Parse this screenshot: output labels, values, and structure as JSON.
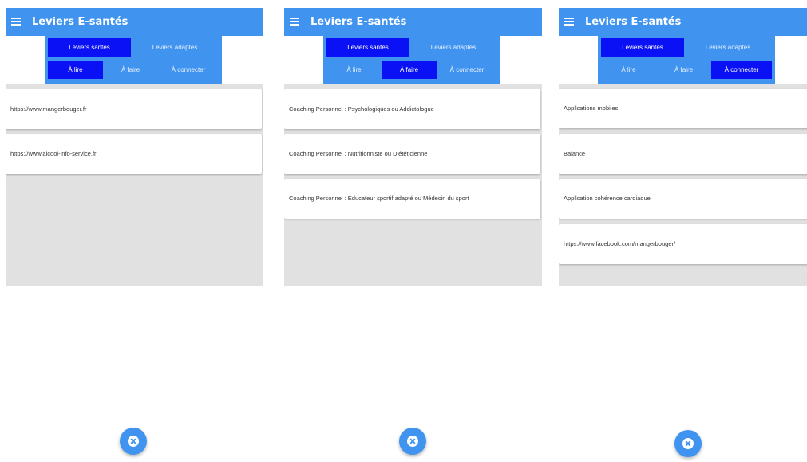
{
  "colors": {
    "primary": "#4094f0",
    "active_tab": "#0a12f5",
    "content_bg": "#e1e1e1"
  },
  "icons": {
    "menu": "hamburger-menu-icon",
    "fab": "close-circle-icon"
  },
  "panels": [
    {
      "app_title": "Leviers E-santés",
      "top_tabs": [
        "Leviers santés",
        "Leviers adaptés"
      ],
      "sub_tabs": [
        "À lire",
        "À faire",
        "À connecter"
      ],
      "active_top": "Leviers santés",
      "active_sub": "À lire",
      "items": [
        "https://www.mangerbouger.fr",
        "https://www.alcool-info-service.fr"
      ]
    },
    {
      "app_title": "Leviers E-santés",
      "top_tabs": [
        "Leviers santés",
        "Leviers adaptés"
      ],
      "sub_tabs": [
        "À lire",
        "À faire",
        "À connecter"
      ],
      "active_top": "Leviers santés",
      "active_sub": "À faire",
      "items": [
        "Coaching Personnel : Psychologiques ou Addictologue",
        "Coaching Personnel : Nutritionniste ou Diététicienne",
        "Coaching Personnel : Éducateur sportif adapté ou Médecin du sport"
      ]
    },
    {
      "app_title": "Leviers E-santés",
      "top_tabs": [
        "Leviers santés",
        "Leviers adaptés"
      ],
      "sub_tabs": [
        "À lire",
        "À faire",
        "À connecter"
      ],
      "active_top": "Leviers santés",
      "active_sub": "À connecter",
      "items": [
        "Applications mobiles",
        "Balance",
        "Application cohérence cardiaque",
        "https://www.facebook.com/mangerbouger/"
      ]
    }
  ]
}
